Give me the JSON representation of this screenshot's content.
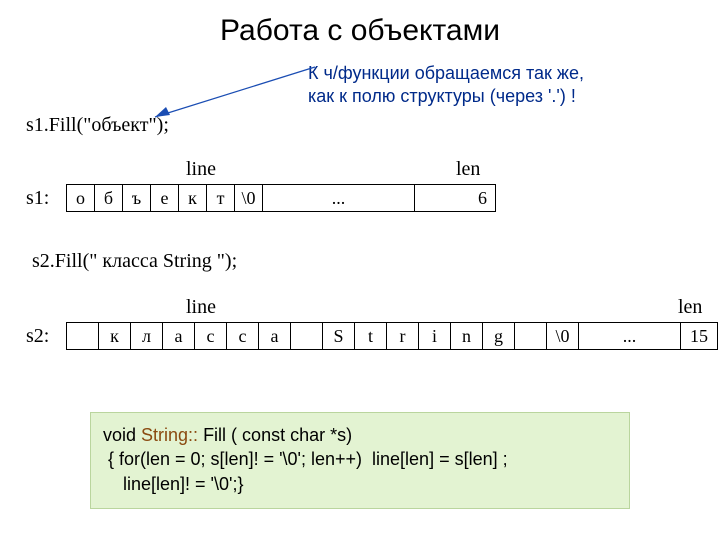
{
  "title": "Работа с объектами",
  "note_line1": "К ч/функции обращаемся так же,",
  "note_line2": "как к полю структуры (через '.') !",
  "call1": "s1.Fill(\"объект\");",
  "call2": "s2.Fill(\" класса String \");",
  "table1": {
    "obj": "s1:",
    "line_label": "line",
    "len_label": "len",
    "cells": [
      "о",
      "б",
      "ъ",
      "е",
      "к",
      "т",
      "\\0"
    ],
    "dots": "...",
    "len": "6"
  },
  "table2": {
    "obj": "s2:",
    "line_label": "line",
    "len_label": "len",
    "cells": [
      " ",
      "к",
      "л",
      "а",
      "с",
      "с",
      "а",
      " ",
      "S",
      "t",
      "r",
      "i",
      "n",
      "g",
      " ",
      "\\0"
    ],
    "dots": "...",
    "len": "15"
  },
  "code": {
    "sig_void": "void ",
    "sig_class": "String::",
    "sig_rest": " Fill ( const char *s)",
    "line2": " { for(len = 0; s[len]! = '\\0'; len++)  line[len] = s[len] ;",
    "line3": "    line[len]! = '\\0';}"
  }
}
